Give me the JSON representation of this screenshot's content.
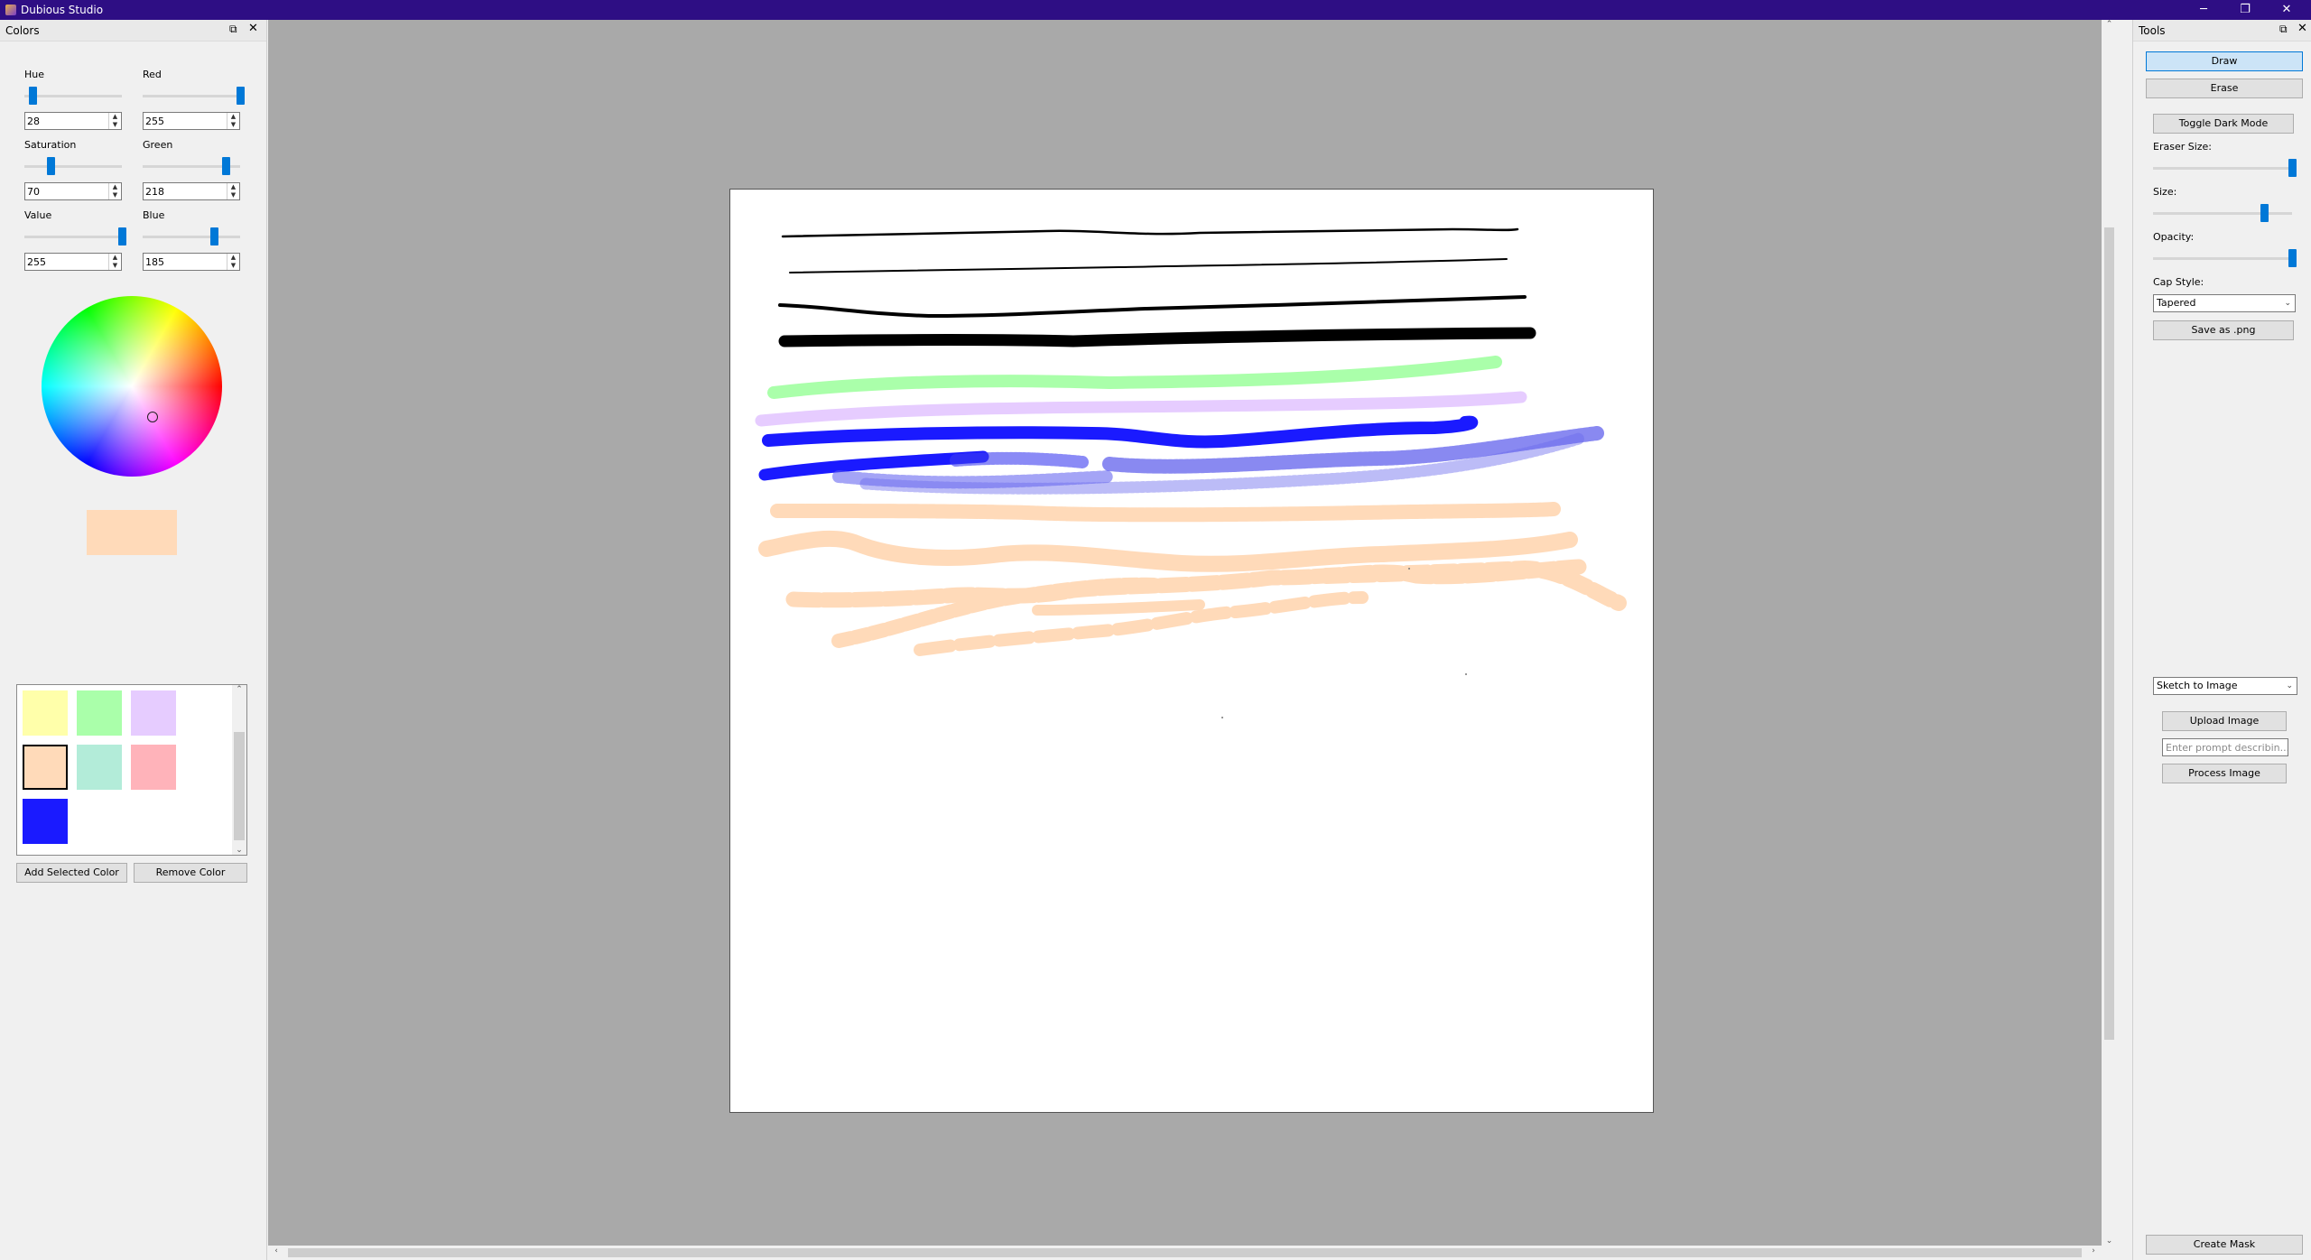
{
  "window": {
    "title": "Dubious Studio",
    "controls": {
      "minimize": "─",
      "maximize": "❐",
      "close": "✕"
    }
  },
  "colors_panel": {
    "title": "Colors",
    "float_glyph": "⧉",
    "close_glyph": "✕",
    "hue": {
      "label": "Hue",
      "value": "28",
      "level": 0.08
    },
    "saturation": {
      "label": "Saturation",
      "value": "70",
      "level": 0.27
    },
    "value": {
      "label": "Value",
      "value": "255",
      "level": 1.0
    },
    "red": {
      "label": "Red",
      "value": "255",
      "level": 1.0
    },
    "green": {
      "label": "Green",
      "value": "218",
      "level": 0.85
    },
    "blue": {
      "label": "Blue",
      "value": "185",
      "level": 0.73
    },
    "selected_color": "#ffdab9",
    "swatches": [
      "#ffffaa",
      "#aaffaa",
      "#e6ccff",
      "#ffdab9",
      "#b3ecd9",
      "#ffb3ba",
      "#1a1aff"
    ],
    "selected_swatch_index": 3,
    "add_button": "Add Selected Color",
    "remove_button": "Remove Color"
  },
  "tools_panel": {
    "title": "Tools",
    "float_glyph": "⧉",
    "close_glyph": "✕",
    "draw_button": "Draw",
    "erase_button": "Erase",
    "toggle_dark_button": "Toggle Dark Mode",
    "eraser_size": {
      "label": "Eraser Size:",
      "level": 1.0
    },
    "size": {
      "label": "Size:",
      "level": 0.8
    },
    "opacity": {
      "label": "Opacity:",
      "level": 1.0
    },
    "cap_style": {
      "label": "Cap Style:",
      "value": "Tapered"
    },
    "save_button": "Save as .png",
    "mode_select": "Sketch to Image",
    "upload_button": "Upload Image",
    "prompt_placeholder": "Enter prompt describin...",
    "process_button": "Process Image",
    "mask_button": "Create Mask"
  },
  "scroll_glyphs": {
    "up": "⌃",
    "down": "⌄",
    "left": "‹",
    "right": "›"
  }
}
